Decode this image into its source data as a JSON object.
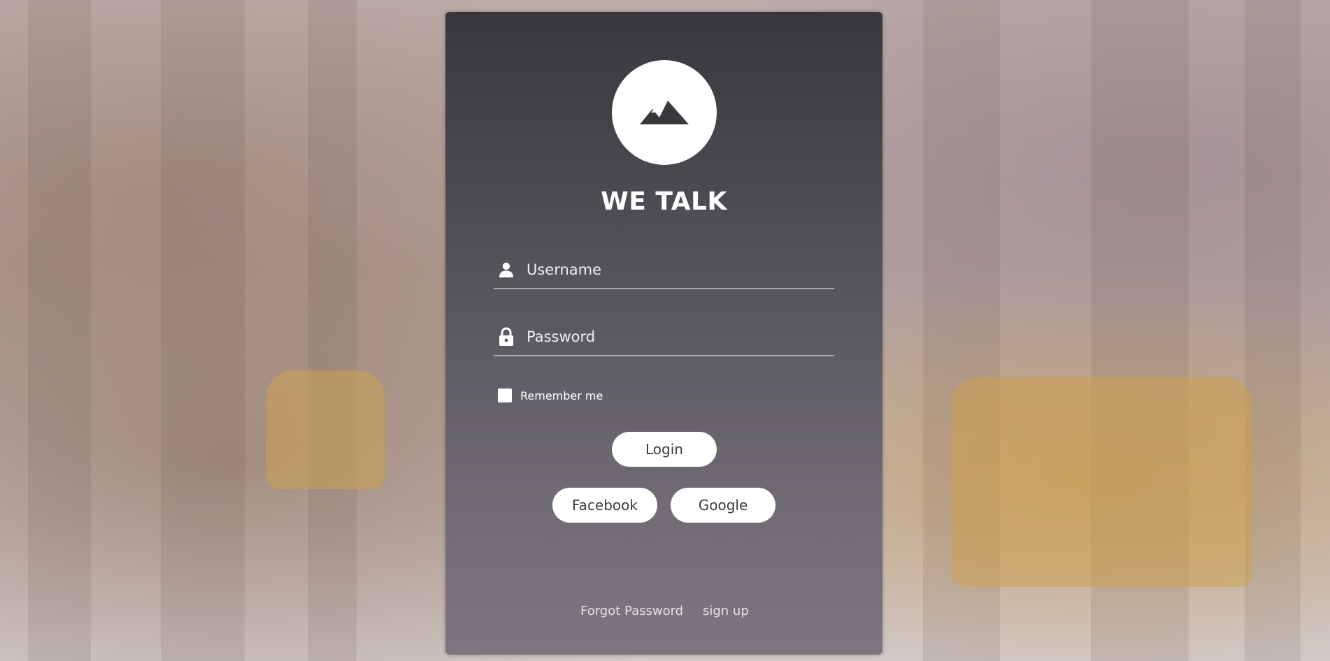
{
  "app": {
    "title": "WE TALK",
    "logo_icon": "mountain-icon"
  },
  "form": {
    "username": {
      "placeholder": "Username",
      "value": "",
      "icon": "user-icon"
    },
    "password": {
      "placeholder": "Password",
      "value": "",
      "icon": "lock-icon"
    },
    "remember_me": {
      "label": "Remember me",
      "checked": false
    },
    "login_label": "Login",
    "social": {
      "facebook_label": "Facebook",
      "google_label": "Google"
    }
  },
  "footer": {
    "forgot_password_label": "Forgot Password",
    "sign_up_label": "sign up"
  },
  "colors": {
    "panel_top": "#39373c",
    "panel_bottom": "#7c7680",
    "button_bg": "#ffffff",
    "text": "#ffffff"
  }
}
